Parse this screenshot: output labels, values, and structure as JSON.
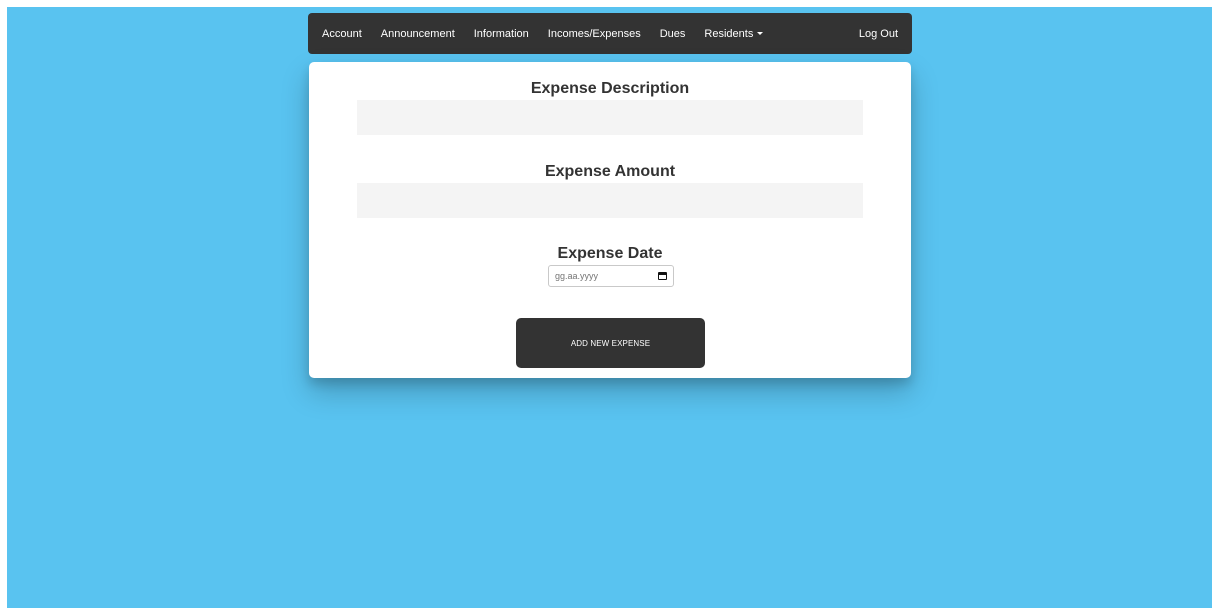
{
  "nav": {
    "items": [
      {
        "label": "Account"
      },
      {
        "label": "Announcement"
      },
      {
        "label": "Information"
      },
      {
        "label": "Incomes/Expenses"
      },
      {
        "label": "Dues"
      },
      {
        "label": "Residents"
      }
    ],
    "logout_label": "Log Out"
  },
  "form": {
    "description_label": "Expense Description",
    "description_value": "",
    "amount_label": "Expense Amount",
    "amount_value": "",
    "date_label": "Expense Date",
    "date_placeholder": "gg.aa.yyyy",
    "submit_label": "ADD NEW EXPENSE"
  },
  "colors": {
    "background": "#59c3f0",
    "navbar": "#333333",
    "card": "#ffffff",
    "input_bg": "#f4f4f4",
    "button": "#333333"
  }
}
